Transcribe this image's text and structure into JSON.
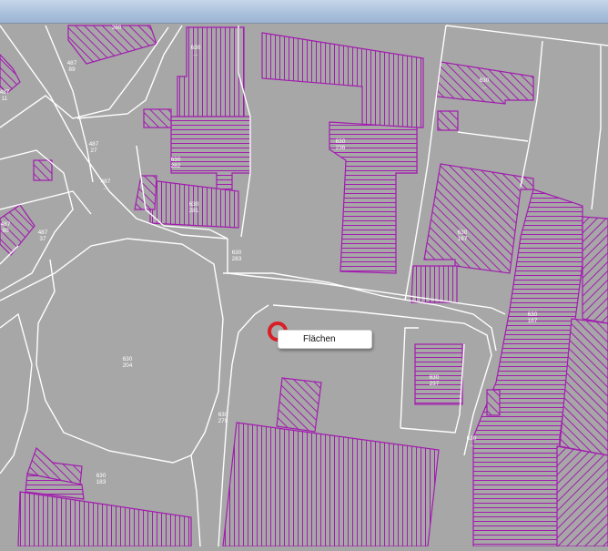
{
  "tooltip": {
    "label": "Flächen"
  },
  "colors": {
    "background": "#a7a7a7",
    "parcel_line": "#ffffff",
    "building_line": "#a21caf",
    "cursor_ring": "#d81f26"
  },
  "parcel_labels": [
    {
      "top": "280",
      "bottom": ""
    },
    {
      "top": "487",
      "bottom": "89"
    },
    {
      "top": "630",
      "bottom": "..."
    },
    {
      "top": "487",
      "bottom": "11"
    },
    {
      "top": "487",
      "bottom": "27"
    },
    {
      "top": "487",
      "bottom": "..."
    },
    {
      "top": "630",
      "bottom": "282"
    },
    {
      "top": "630",
      "bottom": "281"
    },
    {
      "top": "487",
      "bottom": "80"
    },
    {
      "top": "487",
      "bottom": "37"
    },
    {
      "top": "630",
      "bottom": "283"
    },
    {
      "top": "630",
      "bottom": "204"
    },
    {
      "top": "630",
      "bottom": "279"
    },
    {
      "top": "630",
      "bottom": "183"
    },
    {
      "top": "630",
      "bottom": "236"
    },
    {
      "top": "630",
      "bottom": "..."
    },
    {
      "top": "630",
      "bottom": "187"
    },
    {
      "top": "630",
      "bottom": "237"
    },
    {
      "top": "630",
      "bottom": "187"
    },
    {
      "top": "630",
      "bottom": "..."
    }
  ]
}
